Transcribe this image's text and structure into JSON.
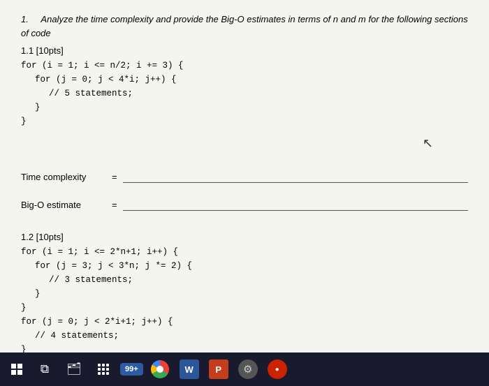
{
  "page": {
    "background": "#f5f5f0"
  },
  "header": {
    "question_number": "1.",
    "question_text": "Analyze the time complexity and provide the Big-O estimates in terms of n and m for the following sections of code"
  },
  "section_1_1": {
    "label": "1.1 [10pts]",
    "code_lines": [
      "for (i = 1; i <= n/2; i += 3) {",
      "    for (j = 0; j < 4*i; j++) {",
      "        // 5 statements;",
      "    }",
      "}"
    ],
    "answer_rows": [
      {
        "label": "Time complexity",
        "equals": "="
      },
      {
        "label": "Big-O estimate",
        "equals": "="
      }
    ]
  },
  "section_1_2": {
    "label": "1.2 [10pts]",
    "code_lines": [
      "for (i = 1; i <= 2*n+1; i++) {",
      "    for (j = 3; j < 3*n; j *= 2) {",
      "        // 3 statements;",
      "    }",
      "}",
      "for (j = 0; j < 2*i+1; j++) {",
      "    // 4 statements;",
      "}"
    ]
  },
  "taskbar": {
    "badge_label": "99+",
    "items": [
      {
        "name": "windows",
        "symbol": "⊞"
      },
      {
        "name": "task-view",
        "symbol": "⧉"
      },
      {
        "name": "file-explorer",
        "symbol": "📁"
      },
      {
        "name": "store",
        "symbol": "🛍"
      },
      {
        "name": "chrome",
        "symbol": ""
      },
      {
        "name": "word",
        "symbol": "W"
      },
      {
        "name": "powerpoint",
        "symbol": "P"
      },
      {
        "name": "settings",
        "symbol": "⚙"
      },
      {
        "name": "redcircle",
        "symbol": ""
      }
    ]
  }
}
